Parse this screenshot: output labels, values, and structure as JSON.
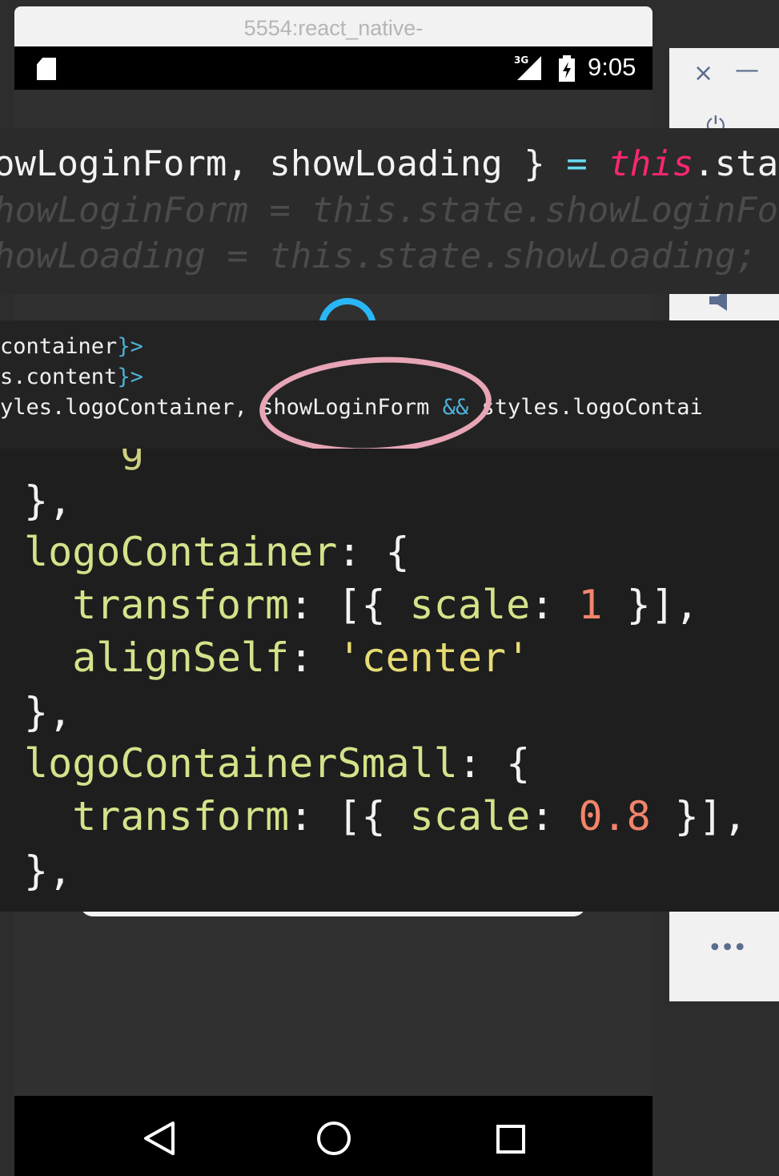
{
  "window": {
    "title": "5554:react_native-"
  },
  "status_bar": {
    "network": "3G",
    "time": "9:05"
  },
  "side_toolbar": {
    "close": "×",
    "minimize": "—",
    "power": "⏻",
    "more": "•••"
  },
  "code_block_1": {
    "line1": {
      "a": "owLoginForm, showLoading } ",
      "b": "=",
      "c": " ",
      "d": "this",
      "e": ".sta"
    },
    "line2": "howLoginForm = this.state.showLoginFo",
    "line3": "howLoading = this.state.showLoading;"
  },
  "code_block_2": {
    "line1": {
      "a": "container",
      "b": "}>"
    },
    "line2": {
      "a": "s.content",
      "b": "}>"
    },
    "line3": {
      "a": "yles.logoContainer, ",
      "b": "showLoginForm",
      "c": " && ",
      "d": "styles.logoContai"
    }
  },
  "code_block_3": {
    "fragment": "` ` g ` ` ` ` `",
    "line1": "},",
    "line2": {
      "a": "logoContainer",
      "b": ": {"
    },
    "line3": {
      "a": "  transform",
      "b": ": [{ ",
      "c": "scale",
      "d": ": ",
      "e": "1",
      "f": " }],"
    },
    "line4": {
      "a": "  alignSelf",
      "b": ": ",
      "c": "'center'"
    },
    "line5": "},",
    "line6": {
      "a": "logoContainerSmall",
      "b": ": {"
    },
    "line7": {
      "a": "  transform",
      "b": ": [{ ",
      "c": "scale",
      "d": ": ",
      "e": "0.8",
      "f": " }],"
    },
    "line8": "},"
  },
  "colors": {
    "accent_spinner": "#29b6f6",
    "highlight_oval": "#e7a5b6",
    "keyword_pink": "#f92672",
    "number_orange": "#f2856b"
  }
}
